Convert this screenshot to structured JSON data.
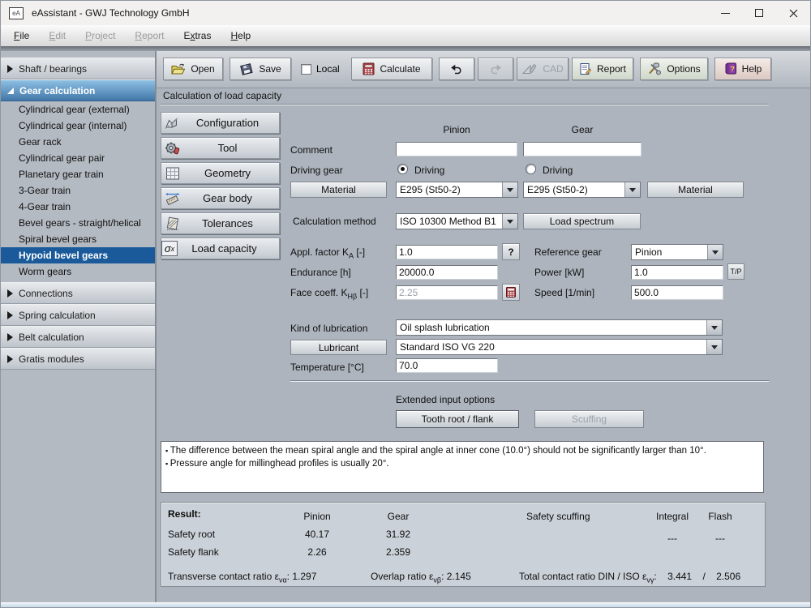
{
  "window": {
    "title": "eAssistant - GWJ Technology GmbH",
    "icon": "eA"
  },
  "menubar": {
    "items": [
      {
        "pre": "",
        "key": "F",
        "rest": "ile",
        "enabled": true
      },
      {
        "pre": "",
        "key": "E",
        "rest": "dit",
        "enabled": false
      },
      {
        "pre": "",
        "key": "P",
        "rest": "roject",
        "enabled": false
      },
      {
        "pre": "",
        "key": "R",
        "rest": "eport",
        "enabled": false
      },
      {
        "pre": "E",
        "key": "x",
        "rest": "tras",
        "enabled": true
      },
      {
        "pre": "",
        "key": "H",
        "rest": "elp",
        "enabled": true
      }
    ]
  },
  "toolbar": {
    "open": "Open",
    "save": "Save",
    "local": "Local",
    "calculate": "Calculate",
    "cad": "CAD",
    "report": "Report",
    "options": "Options",
    "help": "Help"
  },
  "sidebar": {
    "sections": {
      "shaft": "Shaft / bearings",
      "gear": "Gear calculation",
      "connections": "Connections",
      "spring": "Spring calculation",
      "belt": "Belt calculation",
      "gratis": "Gratis modules"
    },
    "gear_items": [
      "Cylindrical gear (external)",
      "Cylindrical gear (internal)",
      "Gear rack",
      "Cylindrical gear pair",
      "Planetary gear train",
      "3-Gear train",
      "4-Gear train",
      "Bevel gears - straight/helical",
      "Spiral bevel gears",
      "Hypoid bevel gears",
      "Worm gears"
    ],
    "selected_item": "Hypoid bevel gears"
  },
  "page_title": "Calculation of load capacity",
  "nav_buttons": {
    "configuration": "Configuration",
    "tool": "Tool",
    "geometry": "Geometry",
    "gear_body": "Gear body",
    "tolerances": "Tolerances",
    "load_capacity": "Load capacity"
  },
  "form": {
    "col_pinion": "Pinion",
    "col_gear": "Gear",
    "comment_label": "Comment",
    "comment_pinion": "",
    "comment_gear": "",
    "driving_label": "Driving gear",
    "driving_pinion": "Driving",
    "driving_gear": "Driving",
    "material_button": "Material",
    "material_pinion": "E295 (St50-2)",
    "material_gear": "E295 (St50-2)",
    "calc_method_label": "Calculation method",
    "calc_method_value": "ISO 10300 Method B1",
    "load_spectrum_button": "Load spectrum",
    "appl_label_pre": "Appl. factor K",
    "appl_label_sub": "A",
    "appl_label_post": " [-]",
    "appl_value": "1.0",
    "help_button": "?",
    "endurance_label": "Endurance [h]",
    "endurance_value": "20000.0",
    "face_label_pre": "Face coeff. K",
    "face_label_sub": "Hβ",
    "face_label_post": " [-]",
    "face_value": "2.25",
    "reference_label": "Reference gear",
    "reference_value": "Pinion",
    "power_label": "Power [kW]",
    "power_value": "1.0",
    "power_button": "T/P",
    "speed_label": "Speed [1/min]",
    "speed_value": "500.0",
    "lubrication_label": "Kind of lubrication",
    "lubrication_value": "Oil splash lubrication",
    "lubricant_button": "Lubricant",
    "lubricant_value": "Standard ISO VG 220",
    "temperature_label": "Temperature [°C]",
    "temperature_value": "70.0",
    "extended_label": "Extended input options",
    "tooth_button": "Tooth root / flank",
    "scuffing_button": "Scuffing"
  },
  "notes": {
    "lines": [
      "The difference between the mean spiral angle and the spiral angle at inner cone (10.0°) should not be significantly larger than 10°.",
      "Pressure angle for millinghead profiles is usually 20°."
    ]
  },
  "result": {
    "title": "Result:",
    "col_pinion": "Pinion",
    "col_gear": "Gear",
    "col_scuffing": "Safety scuffing",
    "col_integral": "Integral",
    "col_flash": "Flash",
    "safety_root_label": "Safety root",
    "safety_root_pinion": "40.17",
    "safety_root_gear": "31.92",
    "scuffing_integral": "---",
    "scuffing_flash": "---",
    "safety_flank_label": "Safety flank",
    "safety_flank_pinion": "2.26",
    "safety_flank_gear": "2.359",
    "transverse_label": "Transverse contact ratio ε",
    "transverse_sub": "vα",
    "transverse_value": ": 1.297",
    "overlap_label": "Overlap ratio ε",
    "overlap_sub": "vβ",
    "overlap_value": ": 2.145",
    "total_label": "Total contact ratio DIN / ISO ε",
    "total_sub": "vγ",
    "total_value": ":    3.441    /    2.506"
  },
  "icons": {
    "help_glyph": "?",
    "load_capacity_glyph": "σ",
    "load_capacity_sub": "x"
  },
  "colors": {
    "selected_blue": "#1a5a9b",
    "header_blue_top": "#8ec0e4",
    "header_blue_bottom": "#4277a8",
    "main_bg": "#adb4bd",
    "result_bg": "#cbd1d8"
  }
}
